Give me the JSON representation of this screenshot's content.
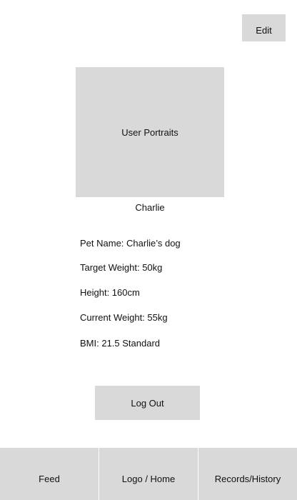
{
  "header": {
    "edit_label": "Edit"
  },
  "profile": {
    "portrait_label": "User Portraits",
    "user_name": "Charlie"
  },
  "details": {
    "pet_name": "Pet Name: Charlie’s dog",
    "target_weight": "Target Weight: 50kg",
    "height": "Height: 160cm",
    "current_weight": "Current Weight: 55kg",
    "bmi": "BMI: 21.5 Standard"
  },
  "actions": {
    "logout_label": "Log Out"
  },
  "nav": {
    "items": [
      {
        "label": "Feed"
      },
      {
        "label": "Logo / Home"
      },
      {
        "label": "Records/History"
      }
    ]
  }
}
